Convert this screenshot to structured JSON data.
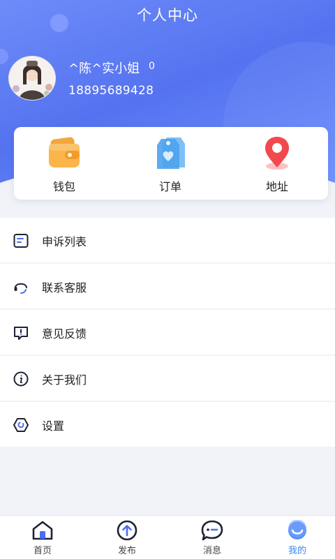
{
  "header": {
    "title": "个人中心"
  },
  "user": {
    "name": "^陈^实小姐",
    "count": "0",
    "phone": "18895689428"
  },
  "quick_actions": [
    {
      "label": "钱包",
      "icon": "wallet-icon"
    },
    {
      "label": "订单",
      "icon": "order-tag-icon"
    },
    {
      "label": "地址",
      "icon": "location-pin-icon"
    }
  ],
  "menu": [
    {
      "label": "申诉列表",
      "icon": "complaint-list-icon"
    },
    {
      "label": "联系客服",
      "icon": "headset-icon"
    },
    {
      "label": "意见反馈",
      "icon": "feedback-icon"
    },
    {
      "label": "关于我们",
      "icon": "info-icon"
    },
    {
      "label": "设置",
      "icon": "settings-icon"
    }
  ],
  "tabbar": {
    "items": [
      {
        "label": "首页",
        "icon": "home-icon"
      },
      {
        "label": "发布",
        "icon": "publish-icon"
      },
      {
        "label": "消息",
        "icon": "message-icon"
      },
      {
        "label": "我的",
        "icon": "profile-icon"
      }
    ],
    "active_index": 3,
    "active_color": "#3b86f7"
  },
  "colors": {
    "header_gradient_start": "#6e8cf8",
    "header_gradient_end": "#6f91ff",
    "accent": "#3b86f7",
    "page_background": "#f1f3f8"
  }
}
